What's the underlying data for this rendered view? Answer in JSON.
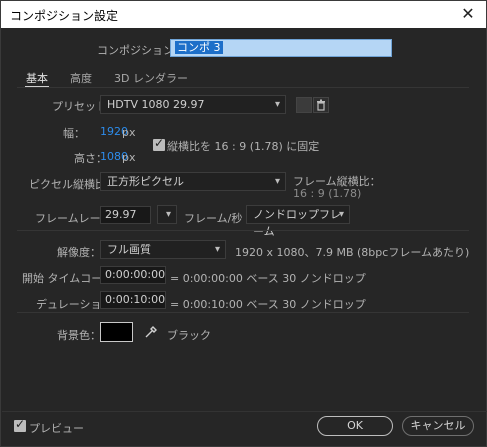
{
  "window": {
    "title": "コンポジション設定",
    "close_glyph": "✕"
  },
  "comp_name": {
    "label": "コンポジション名：",
    "value": "コンポ 3"
  },
  "tabs": [
    {
      "label": "基本"
    },
    {
      "label": "高度"
    },
    {
      "label": "3D レンダラー"
    }
  ],
  "preset": {
    "label": "プリセット：",
    "value": "HDTV 1080 29.97"
  },
  "width": {
    "label": "幅：",
    "value": "1920",
    "unit": "px"
  },
  "height": {
    "label": "高さ：",
    "value": "1080",
    "unit": "px"
  },
  "aspect_lock": {
    "label": "縦横比を 16 : 9 (1.78) に固定",
    "checked": true
  },
  "pixel_aspect": {
    "label": "ピクセル縦横比：",
    "value": "正方形ピクセル"
  },
  "frame_aspect": {
    "label": "フレーム縦横比：",
    "value": "16 : 9 (1.78)"
  },
  "frame_rate": {
    "label": "フレームレート：",
    "value": "29.97",
    "unit": "フレーム/秒",
    "drop_value": "ノンドロップフレーム"
  },
  "resolution": {
    "label": "解像度：",
    "value": "フル画質",
    "info": "1920 x 1080、7.9 MB (8bpcフレームあたり)"
  },
  "start_timecode": {
    "label": "開始 タイムコード：",
    "value": "0:00:00:00",
    "info": "= 0:00:00:00  ベース 30  ノンドロップ"
  },
  "duration": {
    "label": "デュレーション：",
    "value": "0:00:10:00",
    "info": "= 0:00:10:00  ベース 30  ノンドロップ"
  },
  "background": {
    "label": "背景色：",
    "color": "#000000",
    "name": "ブラック"
  },
  "footer": {
    "preview_label": "プレビュー",
    "preview_checked": true,
    "ok_label": "OK",
    "cancel_label": "キャンセル"
  },
  "colors": {
    "accent": "#2d8ceb",
    "panel_bg": "#262626",
    "title_bg": "#ffffff"
  }
}
